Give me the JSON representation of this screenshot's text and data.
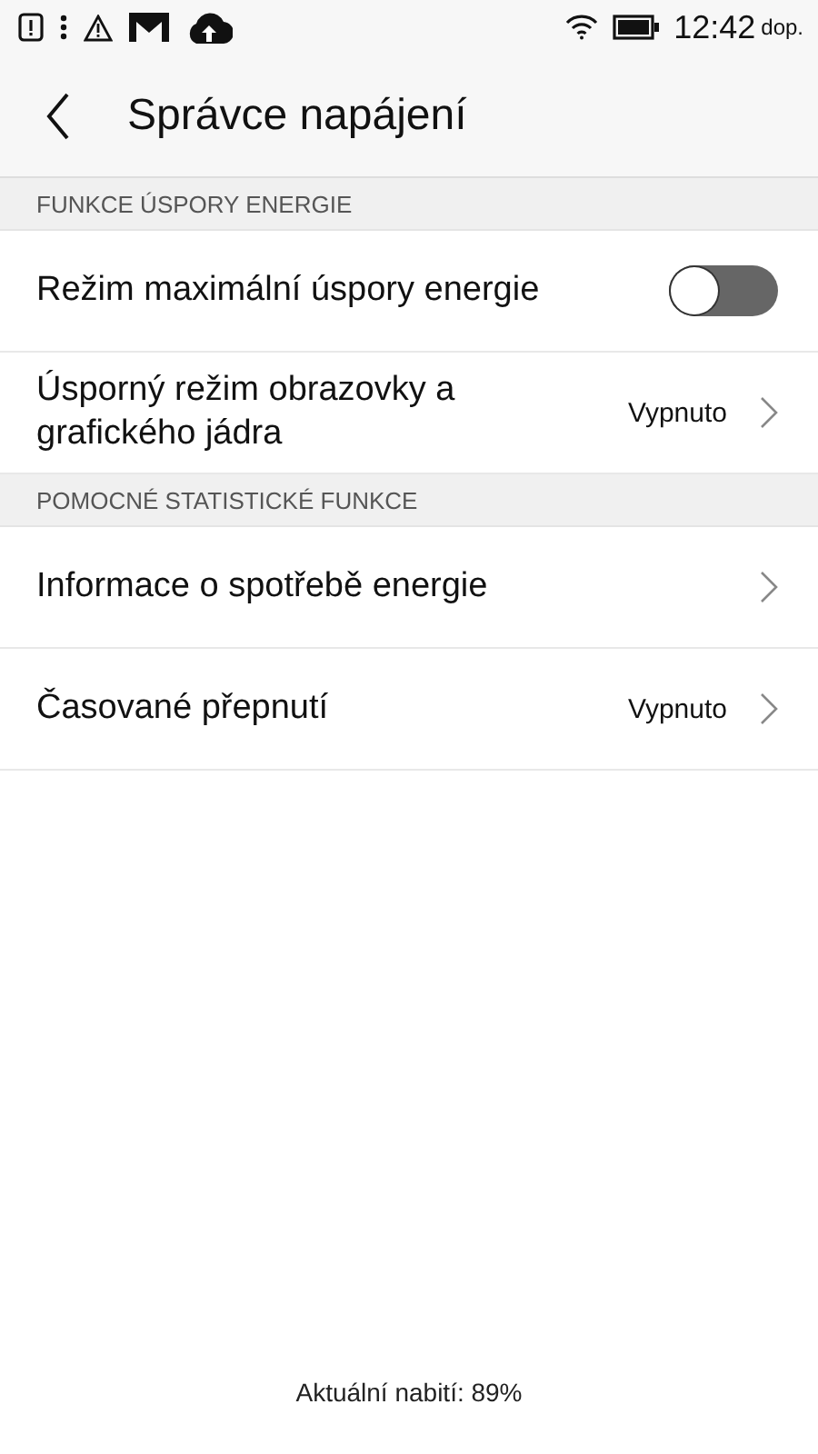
{
  "status_bar": {
    "time": "12:42",
    "time_suffix": "dop."
  },
  "header": {
    "title": "Správce napájení"
  },
  "sections": [
    {
      "title": "FUNKCE ÚSPORY ENERGIE",
      "items": [
        {
          "kind": "toggle",
          "label": "Režim maximální úspory energie",
          "on": false
        },
        {
          "kind": "link",
          "label": "Úsporný režim obrazovky a grafického jádra",
          "value": "Vypnuto"
        }
      ]
    },
    {
      "title": "POMOCNÉ STATISTICKÉ FUNKCE",
      "items": [
        {
          "kind": "link",
          "label": "Informace o spotřebě energie"
        },
        {
          "kind": "link",
          "label": "Časované přepnutí",
          "value": "Vypnuto"
        }
      ]
    }
  ],
  "footer": "Aktuální nabití: 89%"
}
